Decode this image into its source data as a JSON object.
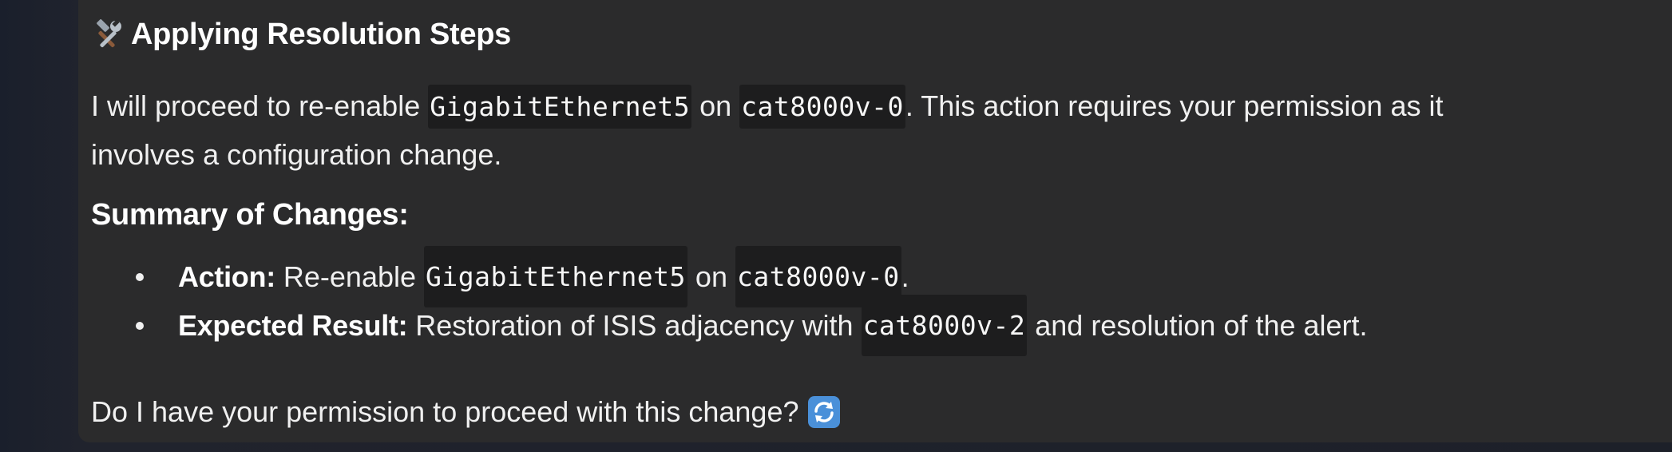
{
  "section": {
    "heading": "Applying Resolution Steps",
    "heading_icon": "hammer-and-wrench-icon"
  },
  "intro": {
    "text_1": "I will proceed to re-enable ",
    "interface": "GigabitEthernet5",
    "text_2": " on ",
    "device": "cat8000v-0",
    "text_3": ". This action requires your permission as it",
    "text_4": "involves a configuration change."
  },
  "summary": {
    "title": "Summary of Changes:",
    "items": [
      {
        "label": "Action:",
        "text_1": "Re-enable ",
        "code_1": "GigabitEthernet5",
        "text_2": " on ",
        "code_2": "cat8000v-0",
        "text_3": "."
      },
      {
        "label": "Expected Result:",
        "text_1": "Restoration of ISIS adjacency with ",
        "code_1": "cat8000v-2",
        "text_2": " and resolution of the alert."
      }
    ]
  },
  "question": {
    "text": "Do I have your permission to proceed with this change?",
    "icon": "refresh-arrows-icon"
  },
  "colors": {
    "card_background": "#2b2b2c",
    "code_background": "#1d1d1e",
    "page_background": "#1b1f2a",
    "refresh_icon_blue": "#4a90d9"
  }
}
